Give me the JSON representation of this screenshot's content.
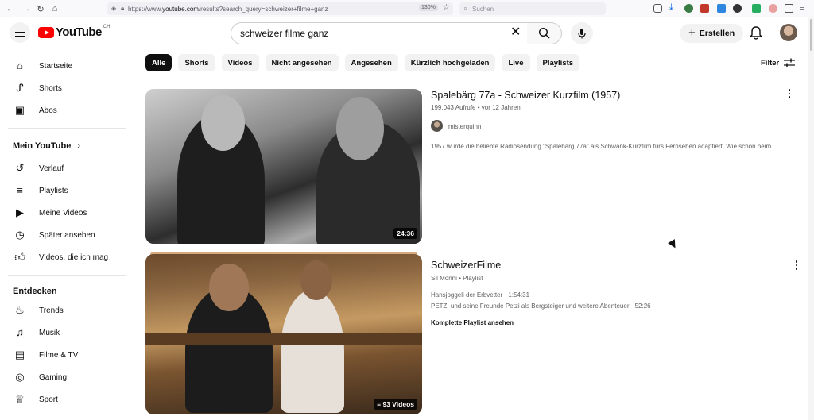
{
  "browser": {
    "url_prefix": "https://www.",
    "url_domain": "youtube.com",
    "url_path": "/results?search_query=schweizer+filme+ganz",
    "zoom": "130%",
    "search_placeholder": "Suchen"
  },
  "header": {
    "logo_text": "YouTube",
    "country_code": "CH",
    "search_query": "schweizer filme ganz",
    "create_label": "Erstellen"
  },
  "sidebar": {
    "main": [
      {
        "label": "Startseite",
        "icon": "home-icon"
      },
      {
        "label": "Shorts",
        "icon": "shorts-icon"
      },
      {
        "label": "Abos",
        "icon": "subscriptions-icon"
      }
    ],
    "you_heading": "Mein YouTube",
    "you": [
      {
        "label": "Verlauf",
        "icon": "history-icon"
      },
      {
        "label": "Playlists",
        "icon": "playlists-icon"
      },
      {
        "label": "Meine Videos",
        "icon": "my-videos-icon"
      },
      {
        "label": "Später ansehen",
        "icon": "watch-later-icon"
      },
      {
        "label": "Videos, die ich mag",
        "icon": "liked-icon"
      }
    ],
    "explore_heading": "Entdecken",
    "explore": [
      {
        "label": "Trends",
        "icon": "trending-icon"
      },
      {
        "label": "Musik",
        "icon": "music-icon"
      },
      {
        "label": "Filme & TV",
        "icon": "movies-icon"
      },
      {
        "label": "Gaming",
        "icon": "gaming-icon"
      },
      {
        "label": "Sport",
        "icon": "sport-icon"
      }
    ]
  },
  "chips": [
    "Alle",
    "Shorts",
    "Videos",
    "Nicht angesehen",
    "Angesehen",
    "Kürzlich hochgeladen",
    "Live",
    "Playlists"
  ],
  "filter_label": "Filter",
  "results": [
    {
      "title": "Spalebärg 77a - Schweizer Kurzfilm (1957)",
      "views": "199.043 Aufrufe",
      "age": "vor 12 Jahren",
      "channel": "misterquinn",
      "description": "1957 wurde die beliebte Radiosendung \"Spalebärg 77a\" als Schwank-Kurzfilm fürs Fernsehen adaptiert. Wie schon beim ...",
      "duration": "24:36"
    },
    {
      "title": "SchweizerFilme",
      "channel": "Sil Monni",
      "kind": "Playlist",
      "items": [
        {
          "name": "Hansjoggeli der Erbvetter",
          "duration": "1:54:31"
        },
        {
          "name": "PETZI und seine Freunde Petzi als Bergsteiger und weitere Abenteuer",
          "duration": "52:26"
        }
      ],
      "view_all": "Komplette Playlist ansehen",
      "video_count": "93 Videos"
    }
  ],
  "colors": {
    "brand_red": "#ff0000",
    "chip_active": "#0f0f0f",
    "chip_bg": "#f2f2f2",
    "meta_text": "#606060"
  }
}
